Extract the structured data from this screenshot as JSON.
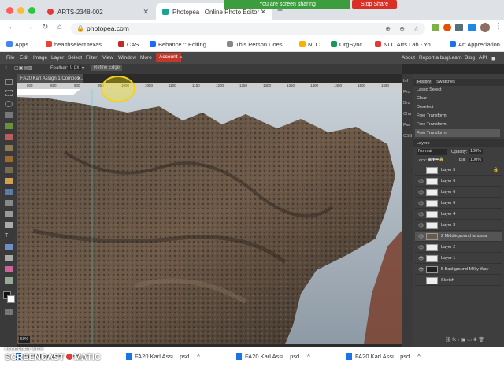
{
  "browser": {
    "tabs": [
      {
        "title": "ARTS-2348-002"
      },
      {
        "title": "Photopea | Online Photo Editor"
      }
    ],
    "new_tab": "+",
    "share_banner": "You are screen sharing",
    "stop_share": "Stop Share",
    "url": "photopea.com"
  },
  "bookmarks": [
    {
      "label": "Apps",
      "color": "#4285f4"
    },
    {
      "label": "healthselect texas...",
      "color": "#ea4335"
    },
    {
      "label": "CAS",
      "color": "#c62828"
    },
    {
      "label": "Behance :: Editing...",
      "color": "#1769ff"
    },
    {
      "label": "This Person Does...",
      "color": "#888888"
    },
    {
      "label": "NLC",
      "color": "#f4b400"
    },
    {
      "label": "OrgSync",
      "color": "#0f9d58"
    },
    {
      "label": "NLC Arts Lab - Yo...",
      "color": "#e53935"
    },
    {
      "label": "Art Appreciation",
      "color": "#1a73e8"
    }
  ],
  "photopea": {
    "menus": [
      "File",
      "Edit",
      "Image",
      "Layer",
      "Select",
      "Filter",
      "View",
      "Window",
      "More",
      "Account"
    ],
    "right_links": [
      "About",
      "Report a bug",
      "Learn",
      "Blog",
      "API"
    ],
    "options": {
      "feather_label": "Feather:",
      "feather_value": "0 px",
      "refine": "Refine Edge"
    },
    "document_tab": "FA20 Karl Assign 1 Compos...",
    "ruler_ticks": [
      "800",
      "850",
      "900",
      "950",
      "1000",
      "1050",
      "1100",
      "1150",
      "1200",
      "1250",
      "1300",
      "1350",
      "1400",
      "1450",
      "1500",
      "1550"
    ],
    "zoom": "50%",
    "collapsed_tabs": [
      "Inf",
      "Pro",
      "Bru",
      "Cha",
      "Par",
      "CSS"
    ],
    "history_tabs": [
      "History",
      "Swatches"
    ],
    "history": [
      "Lasso Select",
      "Clear",
      "Deselect",
      "Free Transform",
      "Free Transform",
      "Free Transform"
    ],
    "layers_title": "Layers",
    "blend_mode": "Normal",
    "opacity_label": "Opacity:",
    "opacity": "100%",
    "lock_label": "Lock:",
    "fill_label": "Fill:",
    "fill": "100%",
    "layers": [
      "Layer 5",
      "Layer 6",
      "Layer 6",
      "Layer 6",
      "Layer 4",
      "Layer 3",
      "2 Middleground landsca",
      "Layer 2",
      "Layer 1",
      "5 Background Milky Way",
      "Sketch"
    ]
  },
  "downloads": [
    {
      "name": "FA20 Karl Assi....psd"
    },
    {
      "name": "FA20 Karl Assi....psd"
    },
    {
      "name": "FA20 Karl Assi....psd"
    },
    {
      "name": "FA20 Karl Assi....psd"
    }
  ],
  "watermark": {
    "line1": "RECORDED WITH",
    "line2": "SCREENCAST",
    "line3": "MATIC"
  }
}
